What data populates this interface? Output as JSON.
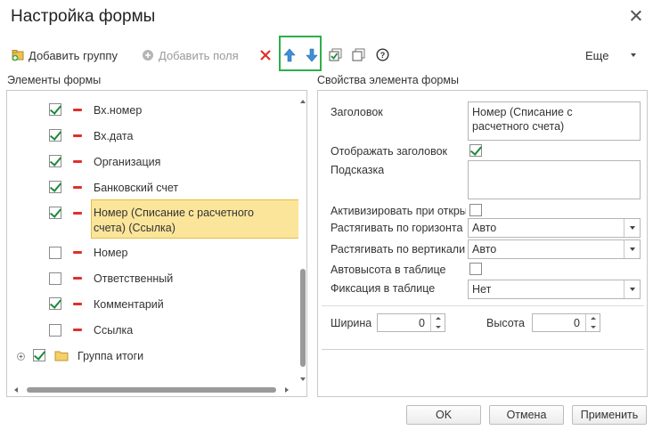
{
  "window": {
    "title": "Настройка формы"
  },
  "toolbar": {
    "add_group": "Добавить группу",
    "add_fields": "Добавить поля",
    "more": "Еще"
  },
  "left_panel": {
    "title": "Элементы формы",
    "items": [
      {
        "label": "Вх.номер",
        "checked": true
      },
      {
        "label": "Вх.дата",
        "checked": true
      },
      {
        "label": "Организация",
        "checked": true
      },
      {
        "label": "Банковский счет",
        "checked": true
      },
      {
        "label_line1": "Номер (Списание с расчетного",
        "label_line2": "счета) (Ссылка)",
        "checked": true,
        "selected": true
      },
      {
        "label": "Номер",
        "checked": false
      },
      {
        "label": "Ответственный",
        "checked": false
      },
      {
        "label": "Комментарий",
        "checked": true
      },
      {
        "label": "Ссылка",
        "checked": false
      },
      {
        "label": "Группа итоги",
        "checked": true,
        "group": true
      }
    ]
  },
  "right_panel": {
    "title": "Свойства элемента формы",
    "header_label": "Заголовок",
    "header_value_line1": "Номер (Списание с",
    "header_value_line2": "расчетного счета)",
    "show_header_label": "Отображать заголовок",
    "show_header_checked": true,
    "hint_label": "Подсказка",
    "hint_value": "",
    "activate_label": "Активизировать при откры",
    "activate_checked": false,
    "stretch_h_label": "Растягивать по горизонта",
    "stretch_h_value": "Авто",
    "stretch_v_label": "Растягивать по вертикали",
    "stretch_v_value": "Авто",
    "autoheight_label": "Автовысота в таблице",
    "autoheight_checked": false,
    "fix_label": "Фиксация в таблице",
    "fix_value": "Нет",
    "width_label": "Ширина",
    "width_value": "0",
    "height_label": "Высота",
    "height_value": "0"
  },
  "buttons": {
    "ok": "OK",
    "cancel": "Отмена",
    "apply": "Применить"
  },
  "colors": {
    "accent_green": "#2eae4a",
    "selected_row": "#fbe59a",
    "delete_red": "#e0302a",
    "arrow_blue": "#3d8fd6"
  }
}
